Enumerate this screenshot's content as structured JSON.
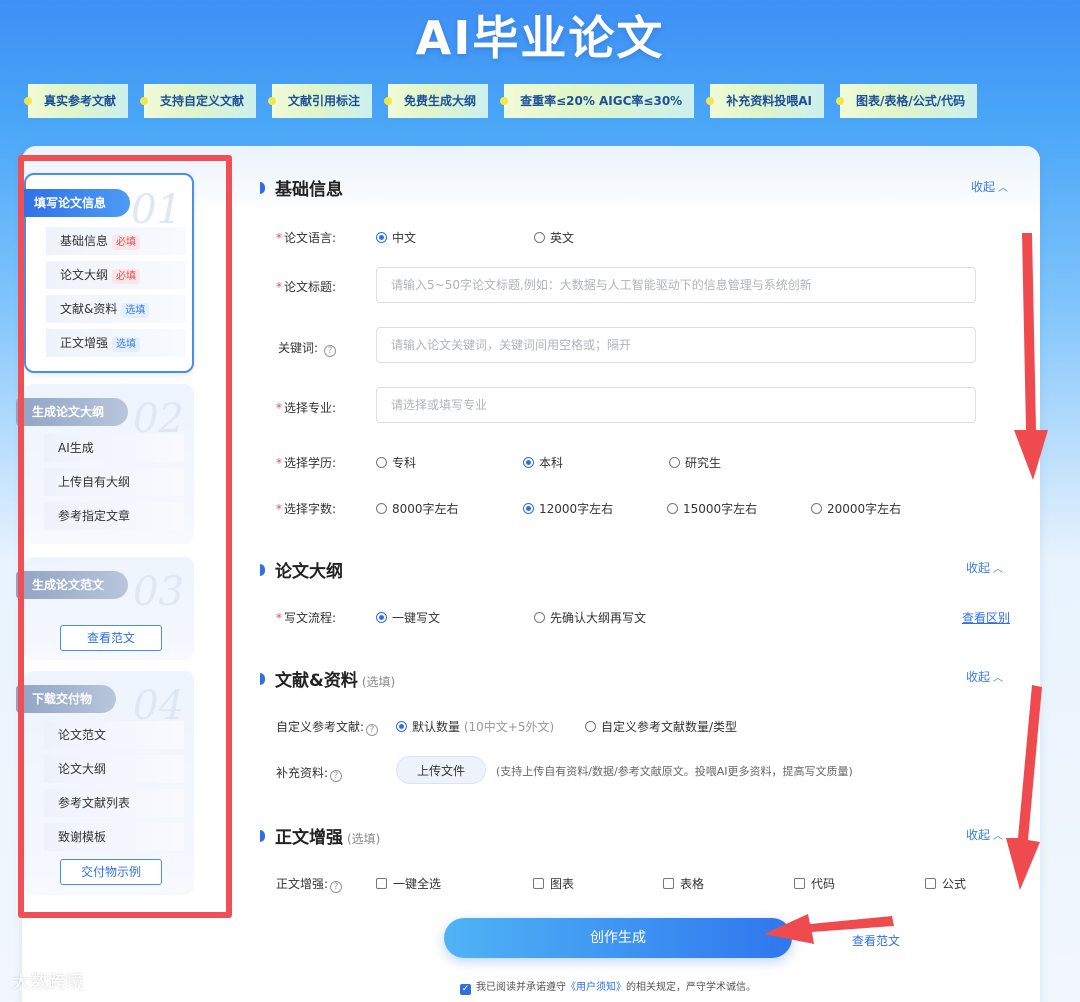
{
  "title": "AI毕业论文",
  "tags": [
    "真实参考文献",
    "支持自定义文献",
    "文献引用标注",
    "免费生成大纲",
    "查重率≤20%  AIGC率≤30%",
    "补充资料投喂AI",
    "图表/表格/公式/代码"
  ],
  "sidebar": {
    "step1": {
      "num": "01",
      "title": "填写论文信息",
      "items": [
        {
          "label": "基础信息",
          "badge": "必填"
        },
        {
          "label": "论文大纲",
          "badge": "必填"
        },
        {
          "label": "文献&资料",
          "badge": "选填"
        },
        {
          "label": "正文增强",
          "badge": "选填"
        }
      ]
    },
    "step2": {
      "num": "02",
      "title": "生成论文大纲",
      "items": [
        "AI生成",
        "上传自有大纲",
        "参考指定文章"
      ]
    },
    "step3": {
      "num": "03",
      "title": "生成论文范文",
      "button": "查看范文"
    },
    "step4": {
      "num": "04",
      "title": "下载交付物",
      "items": [
        "论文范文",
        "论文大纲",
        "参考文献列表",
        "致谢模板"
      ],
      "button": "交付物示例"
    }
  },
  "basic": {
    "title": "基础信息",
    "collapse": "收起",
    "language_label": "论文语言:",
    "language_options": [
      "中文",
      "英文"
    ],
    "title_label": "论文标题:",
    "title_placeholder": "请输入5~50字论文标题,例如：大数据与人工智能驱动下的信息管理与系统创新",
    "keyword_label": "关键词:",
    "keyword_placeholder": "请输入论文关键词，关键词间用空格或；隔开",
    "major_label": "选择专业:",
    "major_placeholder": "请选择或填写专业",
    "degree_label": "选择学历:",
    "degree_options": [
      "专科",
      "本科",
      "研究生"
    ],
    "words_label": "选择字数:",
    "words_options": [
      "8000字左右",
      "12000字左右",
      "15000字左右",
      "20000字左右"
    ]
  },
  "outline": {
    "title": "论文大纲",
    "collapse": "收起",
    "flow_label": "写文流程:",
    "flow_options": [
      "一键写文",
      "先确认大纲再写文"
    ],
    "diff_link": "查看区别"
  },
  "refs": {
    "title": "文献&资料",
    "optional": "(选填)",
    "collapse": "收起",
    "custom_label": "自定义参考文献:",
    "default_option": "默认数量",
    "default_detail": "(10中文+5外文)",
    "custom_option": "自定义参考文献数量/类型",
    "supp_label": "补充资料:",
    "upload_btn": "上传文件",
    "upload_hint": "(支持上传自有资料/数据/参考文献原文。投喂AI更多资料，提高写文质量)"
  },
  "enhance": {
    "title": "正文增强",
    "optional": "(选填)",
    "collapse": "收起",
    "label": "正文增强:",
    "options": [
      "一键全选",
      "图表",
      "表格",
      "代码",
      "公式"
    ]
  },
  "footer": {
    "generate": "创作生成",
    "view_sample": "查看范文",
    "agree_prefix": "我已阅读并承诺遵守",
    "agree_link": "《用户须知》",
    "agree_suffix": "的相关规定，严守学术诚信。",
    "watermark": "大数跨境"
  },
  "colors": {
    "accent": "#2f6fe6",
    "required": "#e24b52",
    "highlight_border": "#f04f55"
  }
}
